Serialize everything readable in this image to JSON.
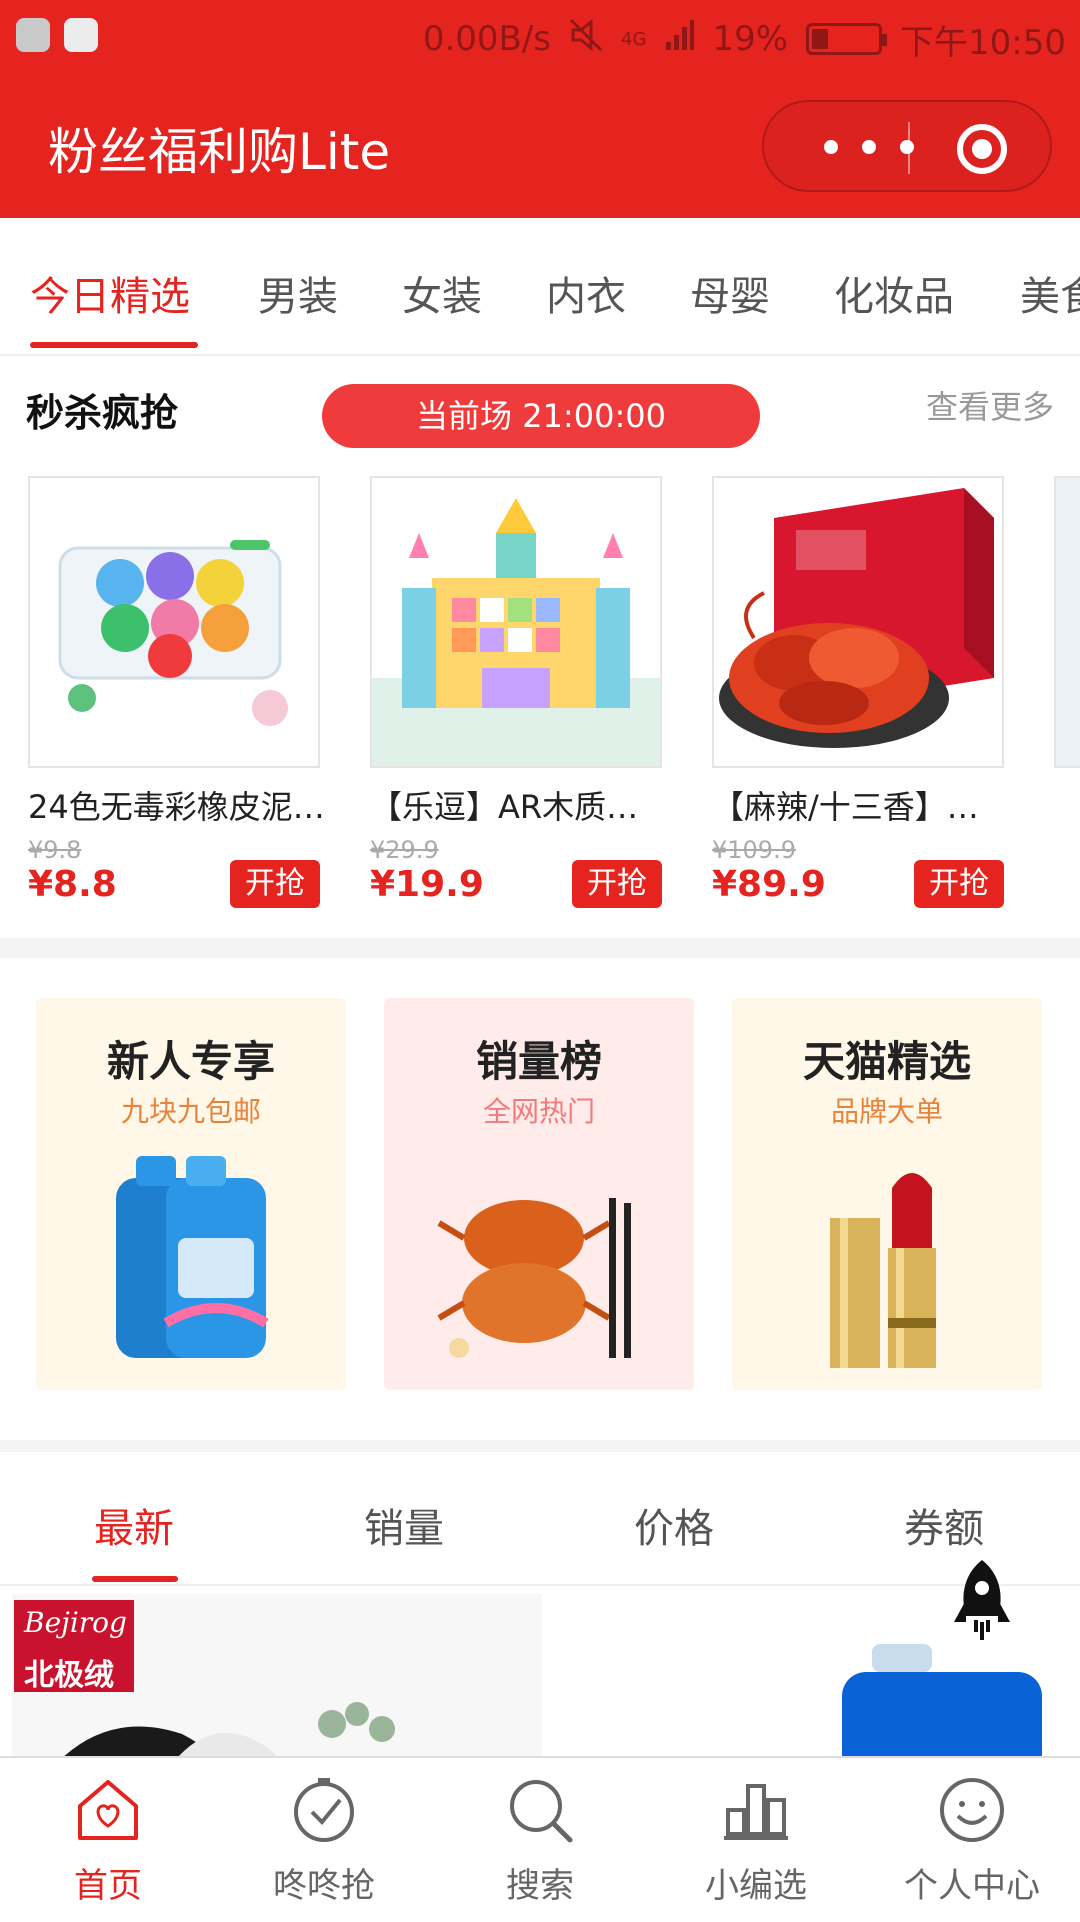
{
  "status_bar": {
    "network_speed": "0.00B/s",
    "signal": "4G",
    "battery": "19%",
    "time": "下午10:50"
  },
  "header": {
    "title": "粉丝福利购Lite",
    "capsule_more": "more-icon",
    "capsule_close": "close-icon"
  },
  "category_tabs": [
    "今日精选",
    "男装",
    "女装",
    "内衣",
    "母婴",
    "化妆品",
    "美食"
  ],
  "flash_sale": {
    "title": "秒杀疯抢",
    "session": "当前场 21:00:00",
    "more": "查看更多",
    "items": [
      {
        "name": "24色无毒彩橡皮泥…",
        "old_price": "¥9.8",
        "price": "¥8.8",
        "button": "开抢"
      },
      {
        "name": "【乐逗】AR木质…",
        "old_price": "¥29.9",
        "price": "¥19.9",
        "button": "开抢"
      },
      {
        "name": "【麻辣/十三香】…",
        "old_price": "¥109.9",
        "price": "¥89.9",
        "button": "开抢"
      }
    ]
  },
  "promo": [
    {
      "title": "新人专享",
      "subtitle": "九块九包邮",
      "bg": "#fff7e8",
      "sub_color": "#e7833a"
    },
    {
      "title": "销量榜",
      "subtitle": "全网热门",
      "bg": "#ffecea",
      "sub_color": "#f27a7a"
    },
    {
      "title": "天猫精选",
      "subtitle": "品牌大单",
      "bg": "#fff7e8",
      "sub_color": "#e7833a"
    }
  ],
  "sort_tabs": [
    "最新",
    "销量",
    "价格",
    "券额"
  ],
  "products": {
    "brand_script": "Bejirog",
    "brand_name": "北极绒"
  },
  "bottom_nav": [
    {
      "label": "首页",
      "icon": "home-icon",
      "active": true
    },
    {
      "label": "咚咚抢",
      "icon": "check-clock-icon",
      "active": false
    },
    {
      "label": "搜索",
      "icon": "search-icon",
      "active": false
    },
    {
      "label": "小编选",
      "icon": "chart-icon",
      "active": false
    },
    {
      "label": "个人中心",
      "icon": "smile-icon",
      "active": false
    }
  ],
  "colors": {
    "brand": "#e52420",
    "accent_pill": "#ef3b3b"
  }
}
